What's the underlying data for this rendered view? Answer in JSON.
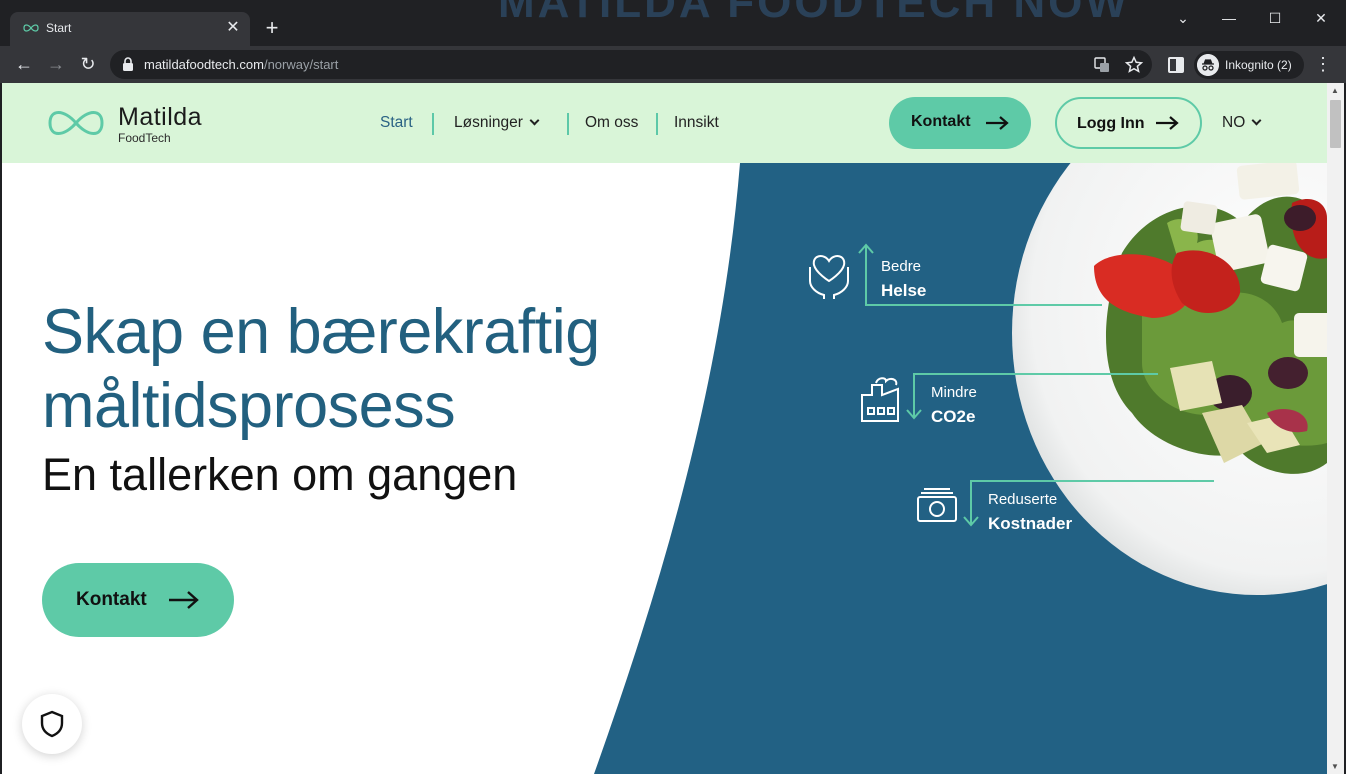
{
  "browser": {
    "tab_title": "Start",
    "tab_close": "✕",
    "new_tab": "+",
    "url_domain": "matildafoodtech.com",
    "url_path": "/norway/start",
    "incognito_label": "Inkognito (2)",
    "window_controls": {
      "tabs_menu": "⌄",
      "minimize": "—",
      "maximize": "☐",
      "close": "✕"
    },
    "nav": {
      "back": "←",
      "forward": "→",
      "reload": "↻"
    },
    "menu": "⋮"
  },
  "header": {
    "logo_name": "Matilda",
    "logo_sub": "FoodTech",
    "nav_items": [
      {
        "label": "Start"
      },
      {
        "label": "Løsninger"
      },
      {
        "label": "Om oss"
      },
      {
        "label": "Innsikt"
      }
    ],
    "contact_label": "Kontakt",
    "login_label": "Logg Inn",
    "language": "NO"
  },
  "hero": {
    "title": "Skap en bærekraftig måltidsprosess",
    "subtitle": "En tallerken om gangen",
    "cta_label": "Kontakt"
  },
  "features": [
    {
      "line1": "Bedre",
      "line2": "Helse",
      "icon": "heart-hands-icon"
    },
    {
      "line1": "Mindre",
      "line2": "CO2e",
      "icon": "factory-icon"
    },
    {
      "line1": "Reduserte",
      "line2": "Kostnader",
      "icon": "money-icon"
    }
  ],
  "colors": {
    "header_bg": "#d9f5d8",
    "accent_green": "#5ecaa7",
    "brand_blue": "#22607f",
    "hero_panel": "#226184"
  }
}
